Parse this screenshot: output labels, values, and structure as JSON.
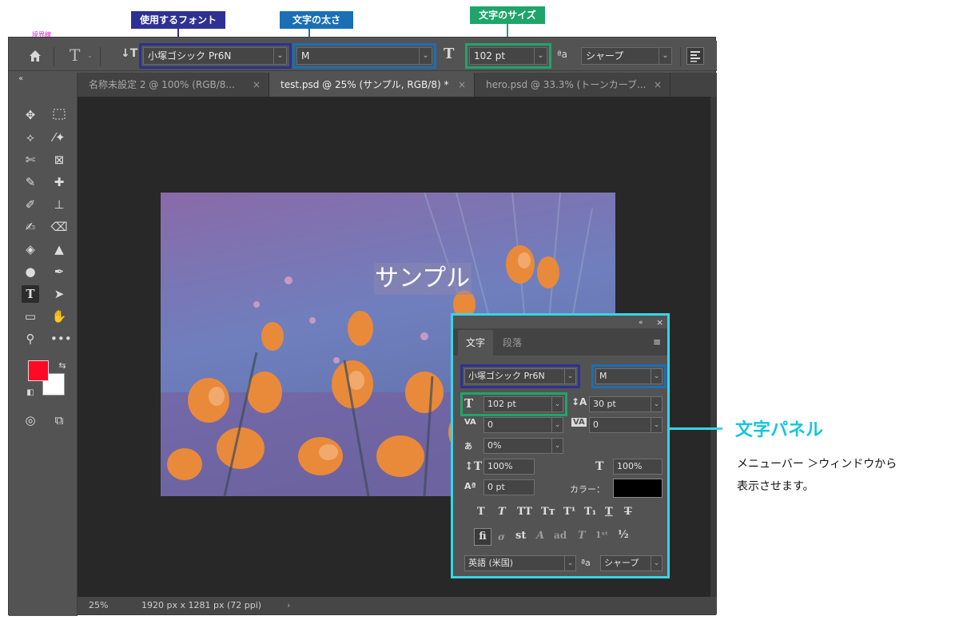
{
  "callouts": {
    "font": "使用するフォント",
    "weight": "文字の太さ",
    "size": "文字のサイズ",
    "tiny_label": "境界線"
  },
  "colors": {
    "font_box": "#2e3192",
    "weight_box": "#1a6fb5",
    "size_box": "#1fa56a",
    "panel_box": "#35d6e6",
    "foreground_swatch": "#ff0a24"
  },
  "options_bar": {
    "font_family": "小塚ゴシック Pr6N",
    "font_weight": "M",
    "font_size": "102 pt",
    "antialias": "シャープ"
  },
  "tabs": [
    {
      "label": "名称未設定 2 @ 100% (RGB/8...",
      "active": false
    },
    {
      "label": "test.psd @ 25% (サンプル, RGB/8) *",
      "active": true
    },
    {
      "label": "hero.psd @ 33.3% (トーンカーブ...",
      "active": false
    }
  ],
  "canvas": {
    "sample_text": "サンプル"
  },
  "status": {
    "zoom": "25%",
    "doc_info": "1920 px x 1281 px (72 ppi)"
  },
  "char_panel": {
    "tab_char": "文字",
    "tab_para": "段落",
    "font_family": "小塚ゴシック Pr6N",
    "font_weight": "M",
    "size": "102 pt",
    "leading": "30 pt",
    "kerning": "0",
    "tracking": "0",
    "tsume": "0%",
    "vscale": "100%",
    "hscale": "100%",
    "baseline": "0 pt",
    "color_label": "カラー：",
    "language": "英語 (米国)",
    "antialias": "シャープ"
  },
  "side_annotation": {
    "title": "文字パネル",
    "line1": "メニューバー ＞ウィンドウから",
    "line2": "表示させます。"
  }
}
